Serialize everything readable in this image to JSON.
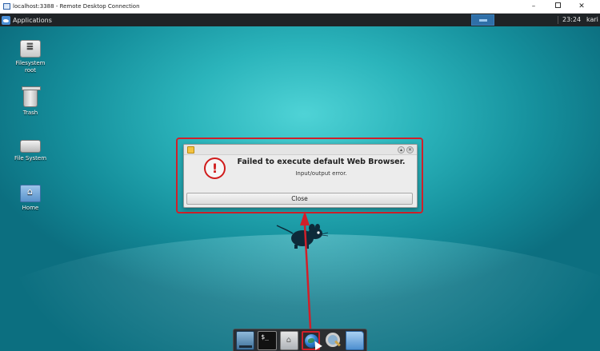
{
  "rdp_window": {
    "title": "localhost:3388 - Remote Desktop Connection",
    "buttons": {
      "minimize": "–",
      "close": "✕"
    }
  },
  "panel": {
    "applications_label": "Applications",
    "clock": "23:24",
    "user": "kari"
  },
  "desktop_icons": {
    "filesystem_root": "Filesystem root",
    "trash": "Trash",
    "file_system": "File System",
    "home": "Home"
  },
  "dialog": {
    "heading": "Failed to execute default Web Browser.",
    "message": "Input/output error.",
    "close_label": "Close",
    "error_glyph": "!",
    "title_buttons": {
      "up": "▴",
      "close": "✕"
    }
  },
  "dock": {
    "terminal_glyph": "$_"
  },
  "colors": {
    "annotation_red": "#d0202a",
    "panel_bg": "#1f2326",
    "desktop_teal": "#2bb4bb"
  },
  "icons": [
    "remote-desktop-icon",
    "xfce-logo-icon",
    "workspace-switcher-icon",
    "filesystem-root-icon",
    "trash-icon",
    "file-system-drive-icon",
    "home-folder-icon",
    "dialog-app-icon",
    "error-icon",
    "xfce-mouse-mascot-icon",
    "show-desktop-icon",
    "terminal-icon",
    "file-manager-icon",
    "web-browser-icon",
    "app-finder-icon",
    "folder-icon",
    "mouse-cursor-icon"
  ]
}
